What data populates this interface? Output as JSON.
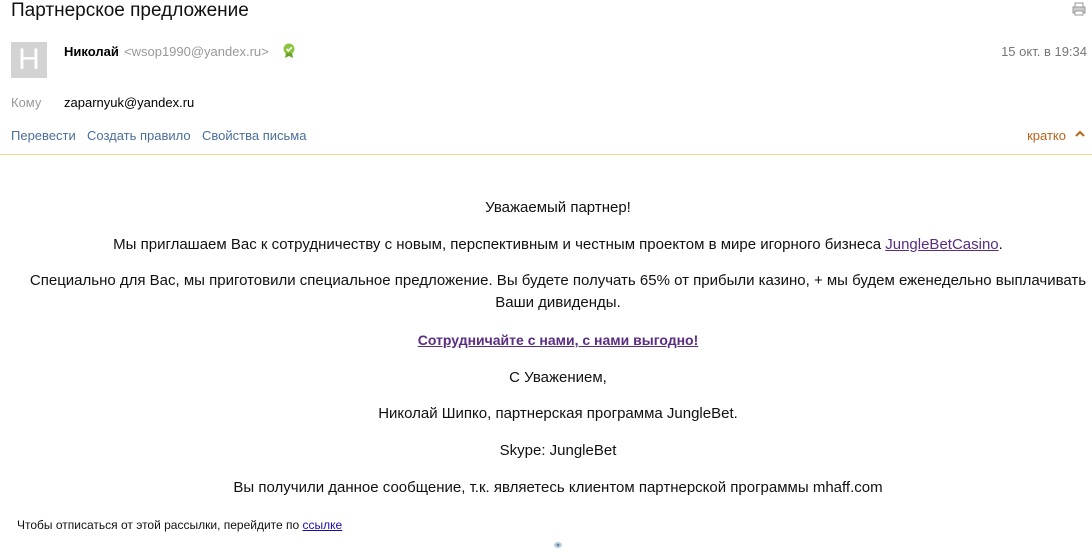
{
  "email": {
    "subject": "Партнерское предложение",
    "sender": {
      "initial": "Н",
      "name": "Николай",
      "email": "<wsop1990@yandex.ru>"
    },
    "date": "15 окт. в 19:34",
    "to_label": "Кому",
    "to_value": "zaparnyuk@yandex.ru",
    "actions": [
      "Перевести",
      "Создать правило",
      "Свойства письма"
    ],
    "brief_label": "кратко"
  },
  "message": {
    "greeting": "Уважаемый партнер!",
    "invite_text": "Мы приглашаем Вас к сотрудничеству с новым, перспективным и честным проектом в мире игорного бизнеса ",
    "invite_link": "JungleBetCasino",
    "offer_line1": "Специально для Вас, мы приготовили специальное предложение. Вы будете получать 65% от прибыли казино, + мы будем еженедельно выплачивать",
    "offer_line2": "Ваши дивиденды.",
    "cta": "Сотрудничайте с нами, с нами выгодно!",
    "regards": "С Уважением,",
    "signature": "Николай Шипко, партнерская программа JungleBet.",
    "skype": "Skype: JungleBet",
    "reason": "Вы получили данное сообщение, т.к. являетесь клиентом партнерской программы mhaff.com",
    "unsubscribe_text": "Чтобы отписаться от этой рассылки, перейдите по ",
    "unsubscribe_link": "ссылке"
  },
  "colors": {
    "link": "#4a6f9a",
    "brief": "#b8631b",
    "divider": "#f0d98a",
    "purple": "#5a2d82"
  },
  "icons": [
    "print-icon",
    "verified-icon",
    "chevron-up-icon"
  ]
}
